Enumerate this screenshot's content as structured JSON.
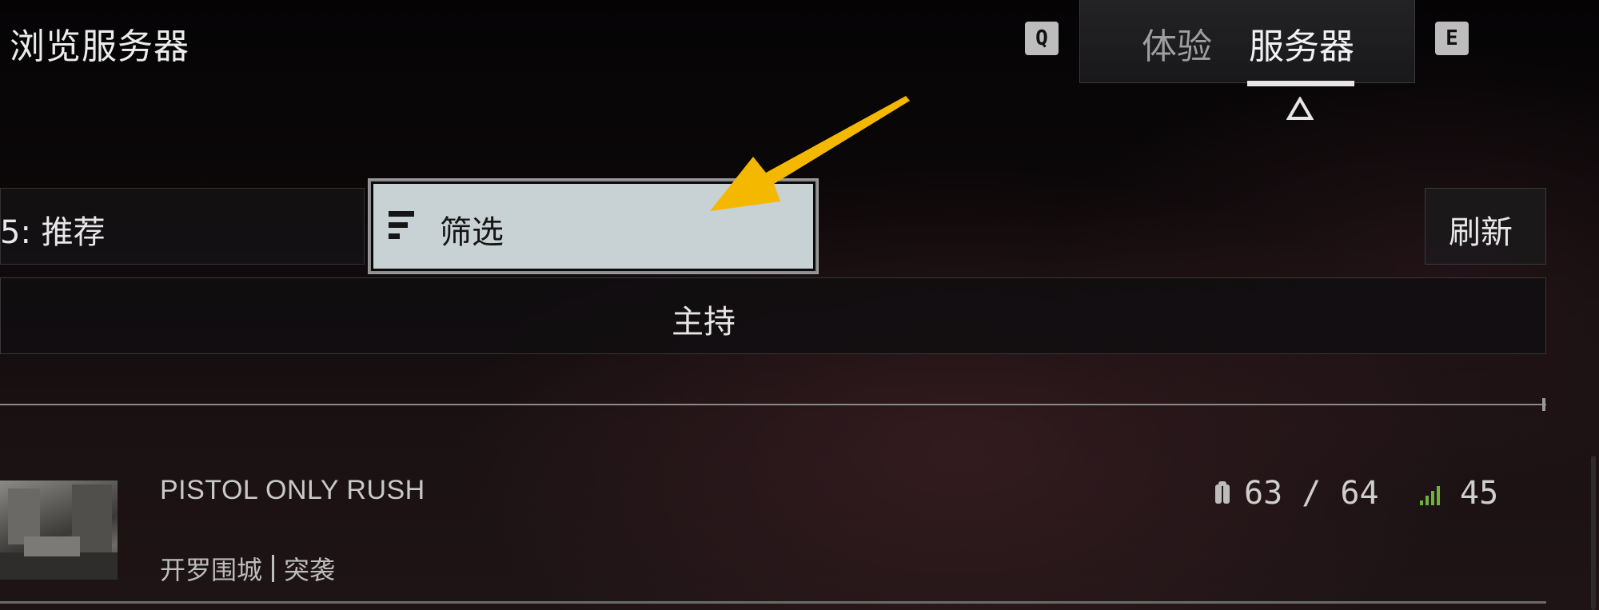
{
  "header": {
    "title": "浏览服务器",
    "left_key": "Q",
    "right_key": "E",
    "tabs": [
      {
        "label": "体验",
        "active": false
      },
      {
        "label": "服务器",
        "active": true
      }
    ]
  },
  "toolbar": {
    "sort_label": "5: 推荐",
    "filter_label": "筛选",
    "refresh_label": "刷新"
  },
  "host_bar": {
    "label": "主持"
  },
  "servers": [
    {
      "name": "PISTOL ONLY RUSH",
      "map": "开罗围城",
      "mode": "突袭",
      "players": "63 / 64",
      "ping": "45"
    }
  ],
  "colors": {
    "filter_bg": "#c8d2d5",
    "arrow": "#f5b800",
    "ping_green": "#6fb33b",
    "tab_active_underline": "#e6e6e6"
  },
  "icons": {
    "filter": "filter-lines-icon",
    "players": "player-icon",
    "ping": "signal-bars-icon",
    "tab_caret": "triangle-caret-icon",
    "annotation": "arrow-annotation-icon"
  }
}
